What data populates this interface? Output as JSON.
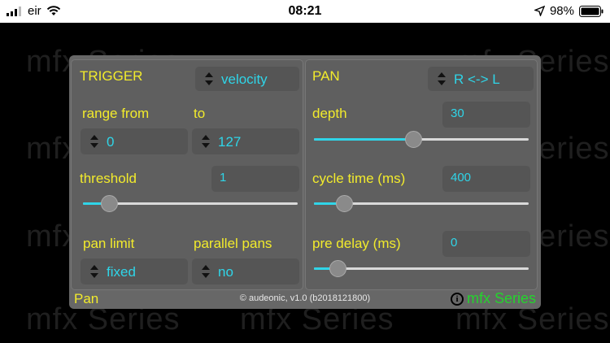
{
  "status_bar": {
    "carrier": "eir",
    "time": "08:21",
    "battery": "98%"
  },
  "background": {
    "word": "mfx Series"
  },
  "trigger": {
    "header": "TRIGGER",
    "mode_value": "velocity",
    "range_from_label": "range from",
    "range_from_value": "0",
    "to_label": "to",
    "to_value": "127",
    "threshold_label": "threshold",
    "threshold_value": "1",
    "threshold_slider_fraction": 0.09,
    "pan_limit_label": "pan limit",
    "pan_limit_value": "fixed",
    "parallel_pans_label": "parallel pans",
    "parallel_pans_value": "no"
  },
  "pan": {
    "header": "PAN",
    "mode_value": "R <-> L",
    "depth_label": "depth",
    "depth_value": "30",
    "depth_slider_fraction": 0.46,
    "cycle_label": "cycle time (ms)",
    "cycle_value": "400",
    "cycle_slider_fraction": 0.11,
    "pre_delay_label": "pre delay (ms)",
    "pre_delay_value": "0",
    "pre_delay_slider_fraction": 0.08
  },
  "footer": {
    "left_label": "Pan",
    "copyright": "© audeonic, v1.0 (b2018121800)",
    "brand": "mfx Series"
  },
  "colors": {
    "label": "#f2eb2c",
    "value": "#2fd5e8",
    "brand": "#24d42d"
  },
  "icons": [
    "cellular-signal-icon",
    "wifi-icon",
    "location-arrow-icon",
    "battery-icon",
    "stepper-arrows-icon",
    "info-icon"
  ]
}
